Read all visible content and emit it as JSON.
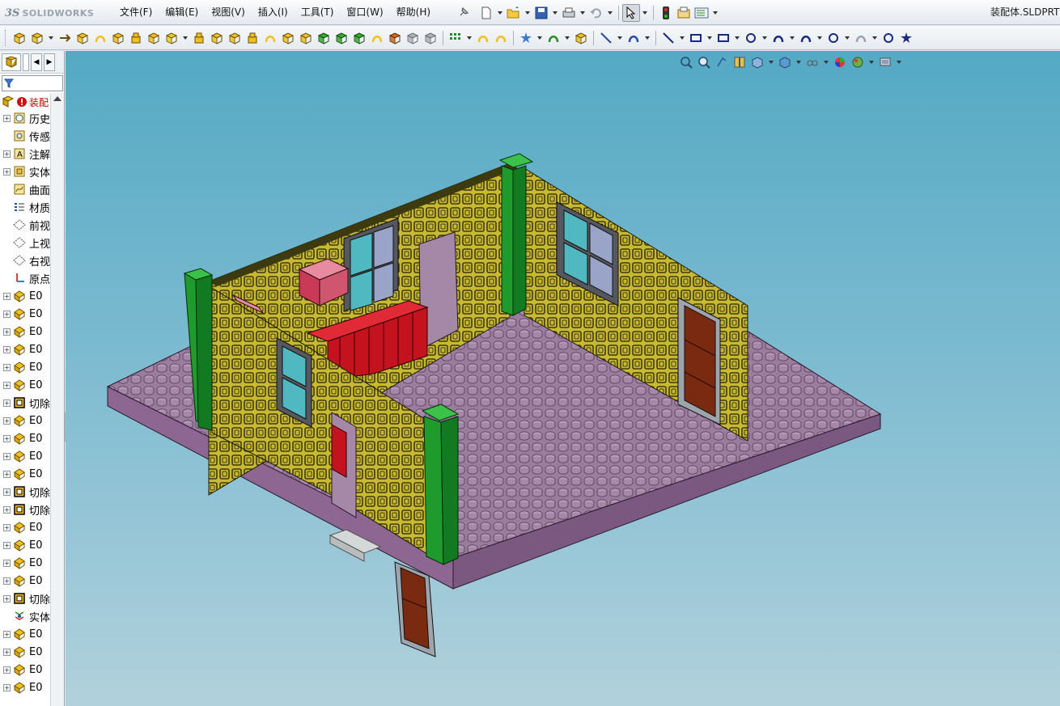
{
  "app": {
    "brand_prefix": "3S",
    "brand_name": "SOLIDWORKS",
    "document_title": "装配体.SLDPRT"
  },
  "menu": {
    "items": [
      {
        "label": "文件(F)"
      },
      {
        "label": "编辑(E)"
      },
      {
        "label": "视图(V)"
      },
      {
        "label": "插入(I)"
      },
      {
        "label": "工具(T)"
      },
      {
        "label": "窗口(W)"
      },
      {
        "label": "帮助(H)"
      }
    ]
  },
  "standard_toolbar": {
    "icons": [
      "new-document-icon",
      "open-icon",
      "save-icon",
      "print-icon",
      "undo-icon",
      "select-icon",
      "rebuild-icon",
      "file-properties-icon",
      "options-icon"
    ]
  },
  "feature_manager": {
    "filter_placeholder": "",
    "root_label": "装配",
    "items": [
      {
        "label": "历史",
        "icon": "history-icon",
        "expandable": true
      },
      {
        "label": "传感",
        "icon": "sensor-icon",
        "expandable": false
      },
      {
        "label": "注解",
        "icon": "annotation-icon",
        "expandable": true
      },
      {
        "label": "实体",
        "icon": "solid-bodies-icon",
        "expandable": true
      },
      {
        "label": "曲面",
        "icon": "surface-bodies-icon",
        "expandable": false
      },
      {
        "label": "材质",
        "icon": "material-icon",
        "expandable": false
      },
      {
        "label": "前视",
        "icon": "plane-icon",
        "expandable": false
      },
      {
        "label": "上视",
        "icon": "plane-icon",
        "expandable": false
      },
      {
        "label": "右视",
        "icon": "plane-icon",
        "expandable": false
      },
      {
        "label": "原点",
        "icon": "origin-icon",
        "expandable": false
      },
      {
        "label": "E0",
        "icon": "part-feature-icon",
        "expandable": true
      },
      {
        "label": "E0",
        "icon": "part-feature-icon",
        "expandable": true
      },
      {
        "label": "E0",
        "icon": "part-feature-icon",
        "expandable": true
      },
      {
        "label": "E0",
        "icon": "part-feature-icon",
        "expandable": true
      },
      {
        "label": "E0",
        "icon": "part-feature-icon",
        "expandable": true
      },
      {
        "label": "E0",
        "icon": "part-feature-icon",
        "expandable": true
      },
      {
        "label": "切除",
        "icon": "cut-icon",
        "expandable": true
      },
      {
        "label": "E0",
        "icon": "part-feature-icon",
        "expandable": true
      },
      {
        "label": "E0",
        "icon": "part-feature-icon",
        "expandable": true
      },
      {
        "label": "E0",
        "icon": "part-feature-icon",
        "expandable": true
      },
      {
        "label": "E0",
        "icon": "part-feature-icon",
        "expandable": true
      },
      {
        "label": "切除",
        "icon": "cut-icon",
        "expandable": true
      },
      {
        "label": "切除",
        "icon": "cut-icon",
        "expandable": true
      },
      {
        "label": "E0",
        "icon": "part-feature-icon",
        "expandable": true
      },
      {
        "label": "E0",
        "icon": "part-feature-icon",
        "expandable": true
      },
      {
        "label": "E0",
        "icon": "part-feature-icon",
        "expandable": true
      },
      {
        "label": "E0",
        "icon": "part-feature-icon",
        "expandable": true
      },
      {
        "label": "切除",
        "icon": "cut-icon",
        "expandable": true
      },
      {
        "label": "实体",
        "icon": "combine-icon",
        "expandable": false
      },
      {
        "label": "E0",
        "icon": "part-feature-icon",
        "expandable": true
      },
      {
        "label": "E0",
        "icon": "part-feature-icon",
        "expandable": true
      },
      {
        "label": "E0",
        "icon": "part-feature-icon",
        "expandable": true
      },
      {
        "label": "E0",
        "icon": "part-feature-icon",
        "expandable": true
      }
    ]
  },
  "colors": {
    "wall": "#c8b832",
    "wall_dark": "#3d3a10",
    "floor": "#a587a8",
    "floor_dark": "#5f3f63",
    "column": "#1f9a2d",
    "cabinet_red": "#c4121f",
    "cabinet_pink": "#c93a58",
    "window_glass": "#4fb8c0",
    "door": "#7a2a10",
    "viewport_top": "#54a9c4",
    "viewport_bottom": "#b1d1dc"
  }
}
